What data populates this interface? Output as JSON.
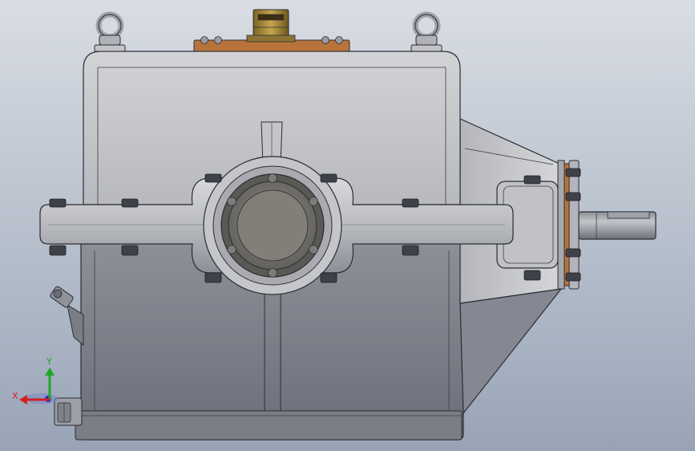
{
  "viewport": {
    "background_top": "#d9dde4",
    "background_bottom": "#98a4b6"
  },
  "model": {
    "colors": {
      "housing_light": "#c9cacd",
      "housing_mid": "#a9abb0",
      "housing_dark": "#6e717a",
      "outline": "#2b2d33",
      "copper_plate": "#b8733b",
      "brass_breather": "#a8893a",
      "bearing_cap": "#7d7b77"
    },
    "components": [
      "lifting-eye-left",
      "lifting-eye-right",
      "inspection-cover",
      "breather",
      "upper-housing",
      "split-flange",
      "lower-housing",
      "bearing-cap",
      "input-bevel-housing",
      "input-shaft",
      "drain-plug",
      "oil-level-plug"
    ]
  },
  "triad": {
    "x_label": "X",
    "y_label": "Y",
    "x_color": "#d42020",
    "y_color": "#1fa52a",
    "z_color": "#2030c8"
  }
}
